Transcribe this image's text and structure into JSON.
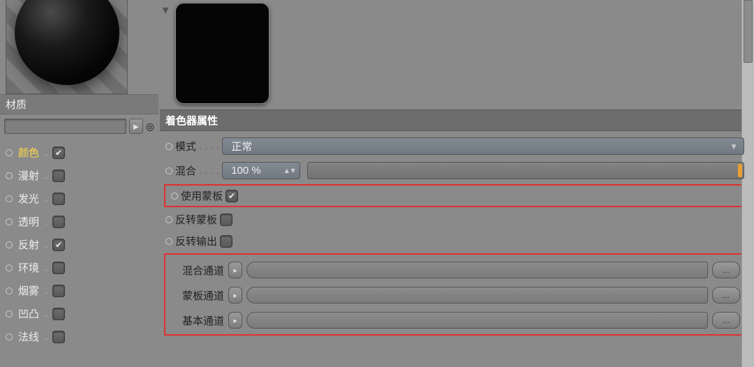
{
  "left": {
    "section_label": "材质",
    "name_value": "",
    "channels": [
      {
        "label": "颜色",
        "checked": true,
        "active": true
      },
      {
        "label": "漫射",
        "checked": false,
        "active": false
      },
      {
        "label": "发光",
        "checked": false,
        "active": false
      },
      {
        "label": "透明",
        "checked": false,
        "active": false
      },
      {
        "label": "反射",
        "checked": true,
        "active": false
      },
      {
        "label": "环境",
        "checked": false,
        "active": false
      },
      {
        "label": "烟雾",
        "checked": false,
        "active": false
      },
      {
        "label": "凹凸",
        "checked": false,
        "active": false
      },
      {
        "label": "法线",
        "checked": false,
        "active": false
      }
    ]
  },
  "shader": {
    "title": "着色器属性",
    "mode_label": "模式",
    "mode_value": "正常",
    "mix_label": "混合",
    "mix_value": "100 %",
    "use_mask_label": "使用蒙板",
    "use_mask_checked": true,
    "invert_mask_label": "反转蒙板",
    "invert_mask_checked": false,
    "invert_output_label": "反转输出",
    "invert_output_checked": false,
    "mix_channel_label": "混合通道",
    "mask_channel_label": "蒙板通道",
    "base_channel_label": "基本通道",
    "ellipsis": "..."
  }
}
